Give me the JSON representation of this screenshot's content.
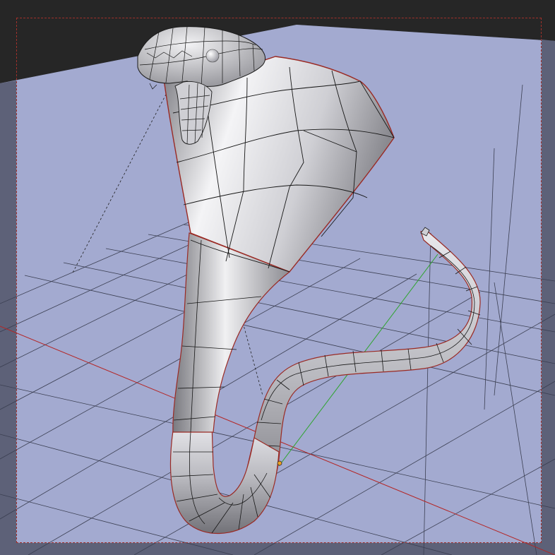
{
  "viewport": {
    "mode": "3d-view",
    "object": "cobra mesh",
    "colors": {
      "world_dark": "#2c2c2c",
      "ground": "#a3aad0",
      "ground_shade": "#5a5e74",
      "grid_line": "#3b3f52",
      "x_axis": "#b42525",
      "y_axis": "#2ea52e",
      "edge": "#161616",
      "camera_border": "#a0302a",
      "mesh_light": "#f2f2f4",
      "mesh_dark": "#6e6e74"
    }
  },
  "mesh": {
    "icons": {
      "object_origin": "origin-dot-icon",
      "eye": "sphere-icon"
    }
  }
}
